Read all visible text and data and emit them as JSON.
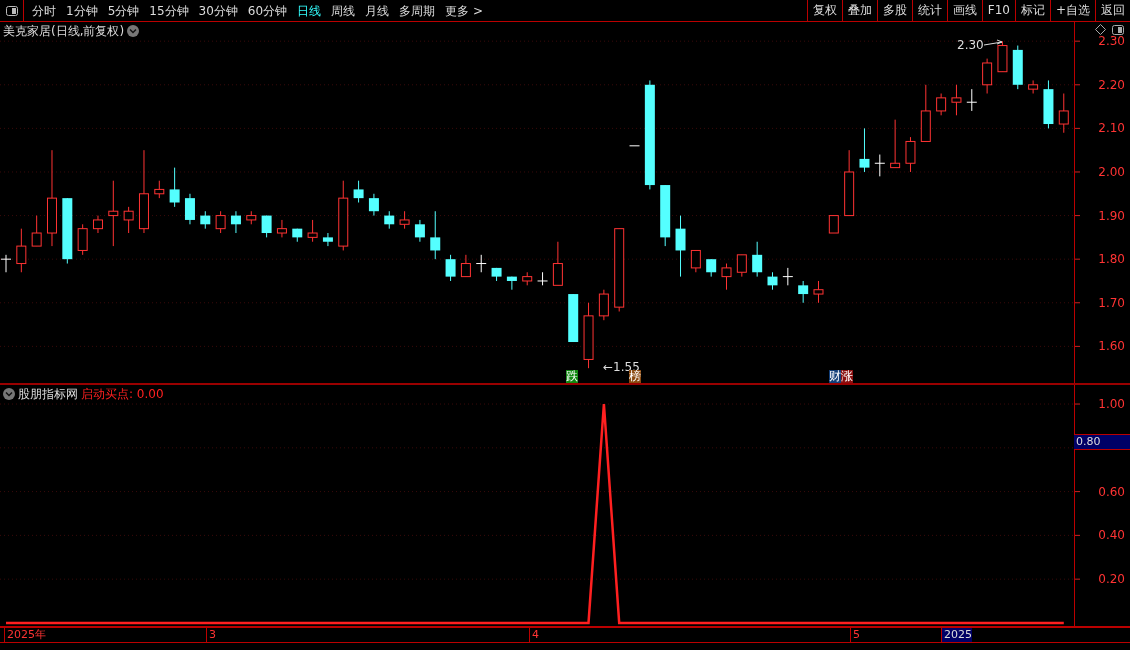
{
  "toolbar": {
    "periods": [
      {
        "label": "分时",
        "selected": false
      },
      {
        "label": "1分钟",
        "selected": false
      },
      {
        "label": "5分钟",
        "selected": false
      },
      {
        "label": "15分钟",
        "selected": false
      },
      {
        "label": "30分钟",
        "selected": false
      },
      {
        "label": "60分钟",
        "selected": false
      },
      {
        "label": "日线",
        "selected": true
      },
      {
        "label": "周线",
        "selected": false
      },
      {
        "label": "月线",
        "selected": false
      },
      {
        "label": "多周期",
        "selected": false
      },
      {
        "label": "更多 >",
        "selected": false
      }
    ],
    "buttons": [
      "复权",
      "叠加",
      "多股",
      "统计",
      "画线",
      "F10",
      "标记",
      "+自选",
      "返回"
    ]
  },
  "price_chart": {
    "title": "美克家居(日线,前复权)",
    "high_label": "2.30",
    "low_label": "←1.55",
    "tags": [
      {
        "text": "跌",
        "color": "#118811"
      },
      {
        "text": "榜",
        "color": "#8a4a10"
      },
      {
        "text": "财",
        "color": "#123e78"
      },
      {
        "text": "涨",
        "color": "#8a1010"
      }
    ],
    "chart_data": {
      "type": "candlestick",
      "grid": true,
      "ylim": [
        1.516,
        2.344
      ],
      "yticks": [
        {
          "value": 2.3,
          "label": "2.30"
        },
        {
          "value": 2.2,
          "label": "2.20"
        },
        {
          "value": 2.1,
          "label": "2.10"
        },
        {
          "value": 2.0,
          "label": "2.00"
        },
        {
          "value": 1.9,
          "label": "1.90"
        },
        {
          "value": 1.8,
          "label": "1.80"
        },
        {
          "value": 1.7,
          "label": "1.70"
        },
        {
          "value": 1.6,
          "label": "1.60"
        }
      ],
      "ohlc": [
        [
          1.8,
          1.81,
          1.77,
          1.8
        ],
        [
          1.79,
          1.87,
          1.77,
          1.83
        ],
        [
          1.83,
          1.9,
          1.83,
          1.86
        ],
        [
          1.86,
          2.05,
          1.83,
          1.94
        ],
        [
          1.94,
          1.94,
          1.79,
          1.8
        ],
        [
          1.82,
          1.88,
          1.81,
          1.87
        ],
        [
          1.87,
          1.9,
          1.86,
          1.89
        ],
        [
          1.9,
          1.98,
          1.83,
          1.91
        ],
        [
          1.89,
          1.92,
          1.86,
          1.91
        ],
        [
          1.87,
          2.05,
          1.86,
          1.95
        ],
        [
          1.95,
          1.98,
          1.94,
          1.96
        ],
        [
          1.96,
          2.01,
          1.92,
          1.93
        ],
        [
          1.94,
          1.95,
          1.88,
          1.89
        ],
        [
          1.9,
          1.91,
          1.87,
          1.88
        ],
        [
          1.87,
          1.91,
          1.86,
          1.9
        ],
        [
          1.9,
          1.91,
          1.86,
          1.88
        ],
        [
          1.89,
          1.91,
          1.88,
          1.9
        ],
        [
          1.9,
          1.9,
          1.85,
          1.86
        ],
        [
          1.86,
          1.89,
          1.85,
          1.87
        ],
        [
          1.87,
          1.87,
          1.84,
          1.85
        ],
        [
          1.85,
          1.89,
          1.84,
          1.86
        ],
        [
          1.85,
          1.86,
          1.83,
          1.84
        ],
        [
          1.83,
          1.98,
          1.82,
          1.94
        ],
        [
          1.96,
          1.98,
          1.93,
          1.94
        ],
        [
          1.94,
          1.95,
          1.9,
          1.91
        ],
        [
          1.9,
          1.91,
          1.87,
          1.88
        ],
        [
          1.88,
          1.91,
          1.87,
          1.89
        ],
        [
          1.88,
          1.89,
          1.84,
          1.85
        ],
        [
          1.85,
          1.91,
          1.8,
          1.82
        ],
        [
          1.8,
          1.81,
          1.75,
          1.76
        ],
        [
          1.76,
          1.81,
          1.76,
          1.79
        ],
        [
          1.79,
          1.81,
          1.77,
          1.79
        ],
        [
          1.78,
          1.78,
          1.75,
          1.76
        ],
        [
          1.76,
          1.76,
          1.73,
          1.75
        ],
        [
          1.75,
          1.77,
          1.74,
          1.76
        ],
        [
          1.75,
          1.77,
          1.74,
          1.75
        ],
        [
          1.74,
          1.84,
          1.74,
          1.79
        ],
        [
          1.72,
          1.72,
          1.61,
          1.61
        ],
        [
          1.57,
          1.7,
          1.55,
          1.67
        ],
        [
          1.67,
          1.73,
          1.66,
          1.72
        ],
        [
          1.69,
          1.87,
          1.68,
          1.87
        ],
        [
          2.06,
          2.06,
          2.06,
          2.06
        ],
        [
          2.2,
          2.21,
          1.96,
          1.97
        ],
        [
          1.97,
          1.97,
          1.83,
          1.85
        ],
        [
          1.87,
          1.9,
          1.76,
          1.82
        ],
        [
          1.78,
          1.82,
          1.77,
          1.82
        ],
        [
          1.8,
          1.8,
          1.76,
          1.77
        ],
        [
          1.76,
          1.79,
          1.73,
          1.78
        ],
        [
          1.77,
          1.81,
          1.76,
          1.81
        ],
        [
          1.81,
          1.84,
          1.76,
          1.77
        ],
        [
          1.76,
          1.77,
          1.73,
          1.74
        ],
        [
          1.76,
          1.78,
          1.74,
          1.76
        ],
        [
          1.74,
          1.75,
          1.7,
          1.72
        ],
        [
          1.72,
          1.75,
          1.7,
          1.73
        ],
        [
          1.86,
          1.9,
          1.86,
          1.9
        ],
        [
          1.9,
          2.05,
          1.9,
          2.0
        ],
        [
          2.03,
          2.1,
          2.0,
          2.01
        ],
        [
          2.02,
          2.04,
          1.99,
          2.02
        ],
        [
          2.01,
          2.12,
          2.01,
          2.02
        ],
        [
          2.02,
          2.08,
          2.0,
          2.07
        ],
        [
          2.07,
          2.2,
          2.07,
          2.14
        ],
        [
          2.14,
          2.18,
          2.13,
          2.17
        ],
        [
          2.16,
          2.2,
          2.13,
          2.17
        ],
        [
          2.16,
          2.19,
          2.14,
          2.16
        ],
        [
          2.2,
          2.26,
          2.18,
          2.25
        ],
        [
          2.23,
          2.3,
          2.23,
          2.29
        ],
        [
          2.28,
          2.29,
          2.19,
          2.2
        ],
        [
          2.19,
          2.21,
          2.18,
          2.2
        ],
        [
          2.19,
          2.21,
          2.1,
          2.11
        ],
        [
          2.11,
          2.18,
          2.09,
          2.14
        ]
      ]
    }
  },
  "indicator": {
    "name": "股朋指标网",
    "reading": "启动买点: 0.00",
    "cursor_value": "0.80",
    "chart_data": {
      "type": "line",
      "grid": true,
      "ylim": [
        -0.014,
        1.087
      ],
      "yticks": [
        {
          "value": 1.0,
          "label": "1.00"
        },
        {
          "value": 0.6,
          "label": "0.60"
        },
        {
          "value": 0.4,
          "label": "0.40"
        },
        {
          "value": 0.2,
          "label": "0.20"
        }
      ],
      "series": [
        {
          "color": "#ff2020",
          "values": [
            0,
            0,
            0,
            0,
            0,
            0,
            0,
            0,
            0,
            0,
            0,
            0,
            0,
            0,
            0,
            0,
            0,
            0,
            0,
            0,
            0,
            0,
            0,
            0,
            0,
            0,
            0,
            0,
            0,
            0,
            0,
            0,
            0,
            0,
            0,
            0,
            0,
            0,
            0,
            1,
            0,
            0,
            0,
            0,
            0,
            0,
            0,
            0,
            0,
            0,
            0,
            0,
            0,
            0,
            0,
            0,
            0,
            0,
            0,
            0,
            0,
            0,
            0,
            0,
            0,
            0,
            0,
            0,
            0,
            0
          ]
        }
      ]
    }
  },
  "date_axis": [
    "2025年",
    "3",
    "4",
    "5",
    "2025"
  ]
}
